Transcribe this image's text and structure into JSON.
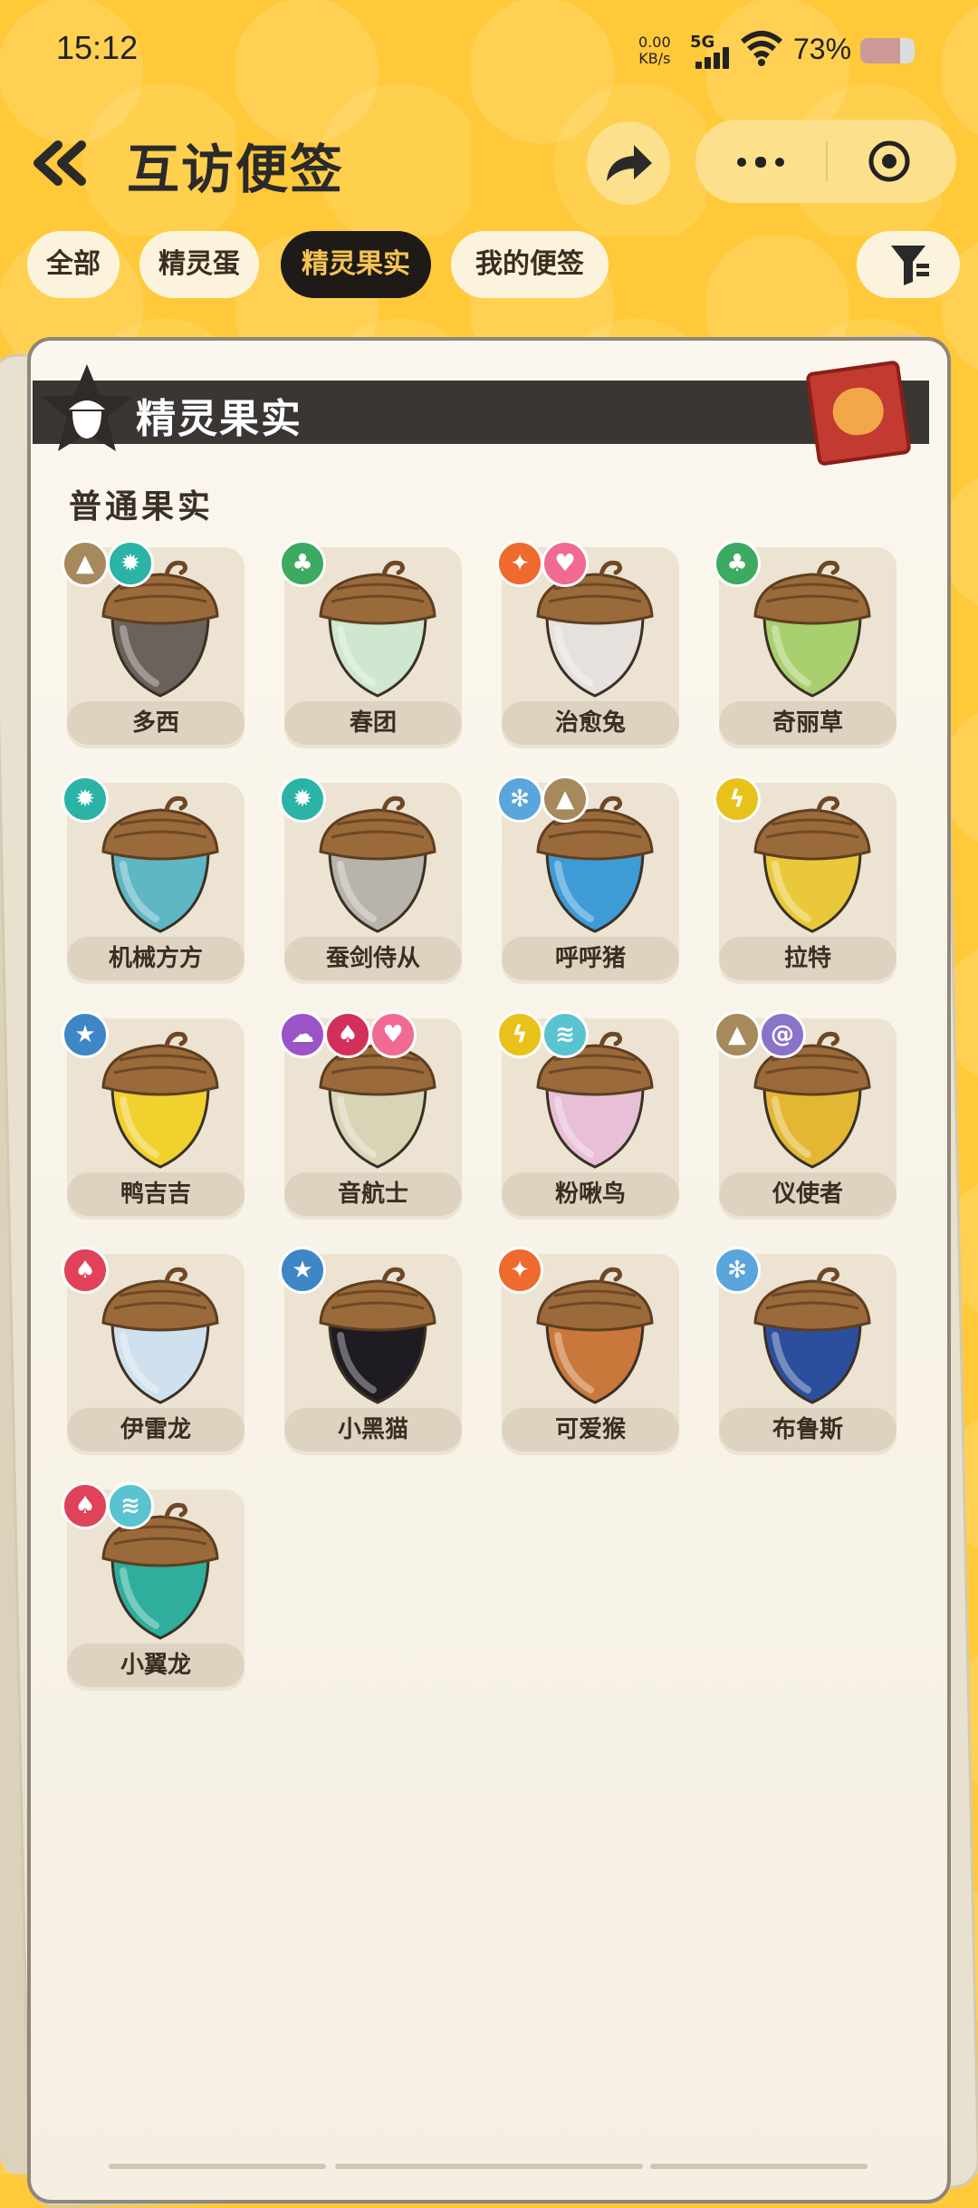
{
  "status": {
    "time": "15:12",
    "net_speed": "0.00",
    "net_unit": "KB/s",
    "signal": "5G",
    "battery": "73%"
  },
  "header": {
    "title": "互访便签"
  },
  "tabs": [
    {
      "label": "全部",
      "active": false
    },
    {
      "label": "精灵蛋",
      "active": false
    },
    {
      "label": "精灵果实",
      "active": true
    },
    {
      "label": "我的便签",
      "active": false
    }
  ],
  "panel": {
    "title": "精灵果实",
    "section_title": "普通果实"
  },
  "fruits": [
    {
      "name": "多西",
      "body": "#6b625c",
      "elements": [
        {
          "icon": "mountain-icon",
          "color": "#a68a5c",
          "glyph": "▲"
        },
        {
          "icon": "gear-icon",
          "color": "#2bb3a6",
          "glyph": "✹"
        }
      ]
    },
    {
      "name": "春团",
      "body": "#cfe6cf",
      "elements": [
        {
          "icon": "leaf-icon",
          "color": "#3daa62",
          "glyph": "♣"
        }
      ]
    },
    {
      "name": "治愈兔",
      "body": "#e7e1de",
      "elements": [
        {
          "icon": "fire-icon",
          "color": "#ef6a2d",
          "glyph": "✦"
        },
        {
          "icon": "heart-icon",
          "color": "#f06a92",
          "glyph": "♥"
        }
      ]
    },
    {
      "name": "奇丽草",
      "body": "#a8d06e",
      "elements": [
        {
          "icon": "leaf-icon",
          "color": "#3daa62",
          "glyph": "♣"
        }
      ]
    },
    {
      "name": "机械方方",
      "body": "#5fb6c4",
      "elements": [
        {
          "icon": "gear-icon",
          "color": "#2bb3a6",
          "glyph": "✹"
        }
      ]
    },
    {
      "name": "蚕剑侍从",
      "body": "#b8b4ac",
      "elements": [
        {
          "icon": "gear-icon",
          "color": "#2bb3a6",
          "glyph": "✹"
        }
      ]
    },
    {
      "name": "呼呼猪",
      "body": "#3d9bd6",
      "elements": [
        {
          "icon": "snowflake-icon",
          "color": "#5aa5dc",
          "glyph": "✻"
        },
        {
          "icon": "mountain-icon",
          "color": "#a68a5c",
          "glyph": "▲"
        }
      ]
    },
    {
      "name": "拉特",
      "body": "#e9c93a",
      "elements": [
        {
          "icon": "lightning-icon",
          "color": "#e8c21a",
          "glyph": "ϟ"
        }
      ]
    },
    {
      "name": "鸭吉吉",
      "body": "#f1d12e",
      "elements": [
        {
          "icon": "star-icon",
          "color": "#3e86c6",
          "glyph": "★"
        }
      ]
    },
    {
      "name": "音航士",
      "body": "#d8d4b6",
      "elements": [
        {
          "icon": "ghost-icon",
          "color": "#9b54c8",
          "glyph": "☁"
        },
        {
          "icon": "demon-icon",
          "color": "#d2305a",
          "glyph": "♠"
        },
        {
          "icon": "heart-icon",
          "color": "#f06a92",
          "glyph": "♥"
        }
      ]
    },
    {
      "name": "粉啾鸟",
      "body": "#e7bfd6",
      "elements": [
        {
          "icon": "lightning-icon",
          "color": "#e8c21a",
          "glyph": "ϟ"
        },
        {
          "icon": "wing-icon",
          "color": "#59c3cf",
          "glyph": "≋"
        }
      ]
    },
    {
      "name": "仪使者",
      "body": "#e3b733",
      "elements": [
        {
          "icon": "mountain-icon",
          "color": "#a68a5c",
          "glyph": "▲"
        },
        {
          "icon": "spiral-icon",
          "color": "#8a73c9",
          "glyph": "@"
        }
      ]
    },
    {
      "name": "伊雷龙",
      "body": "#cfe1ee",
      "elements": [
        {
          "icon": "demon-icon",
          "color": "#e0425a",
          "glyph": "♠"
        }
      ]
    },
    {
      "name": "小黑猫",
      "body": "#1e1b22",
      "elements": [
        {
          "icon": "star-icon",
          "color": "#3e86c6",
          "glyph": "★"
        }
      ]
    },
    {
      "name": "可爱猴",
      "body": "#c9773a",
      "elements": [
        {
          "icon": "fire-icon",
          "color": "#ef6a2d",
          "glyph": "✦"
        }
      ]
    },
    {
      "name": "布鲁斯",
      "body": "#2b4f9c",
      "elements": [
        {
          "icon": "snowflake-icon",
          "color": "#5aa5dc",
          "glyph": "✻"
        }
      ]
    },
    {
      "name": "小翼龙",
      "body": "#2fae9d",
      "elements": [
        {
          "icon": "demon-icon",
          "color": "#e0425a",
          "glyph": "♠"
        },
        {
          "icon": "wing-icon",
          "color": "#59c3cf",
          "glyph": "≋"
        }
      ]
    }
  ]
}
